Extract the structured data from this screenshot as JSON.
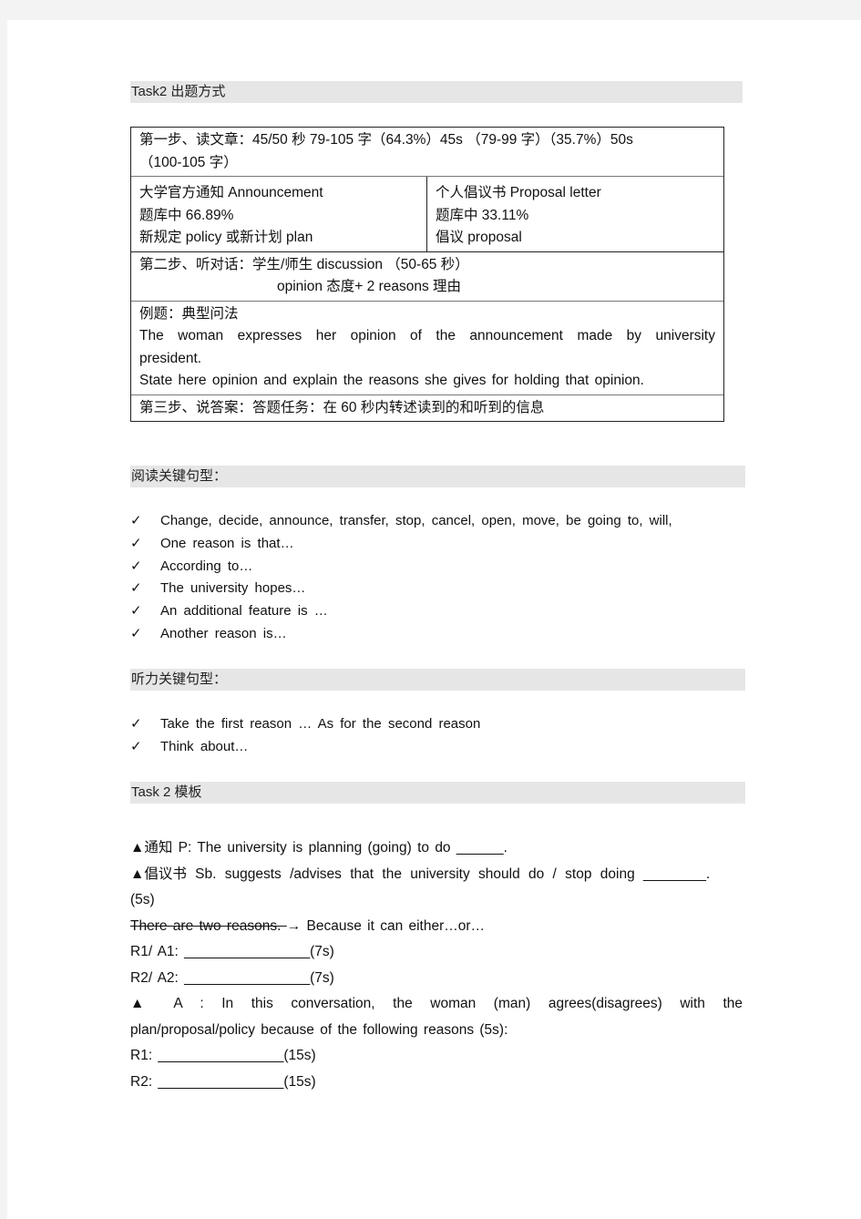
{
  "section1": {
    "header": "Task2   出题方式",
    "table": {
      "step1_line1": "第一步、读文章：45/50 秒  79-105 字（64.3%）45s  （79-99 字）（35.7%）50s",
      "step1_line2": "（100-105 字）",
      "left": [
        "大学官方通知      Announcement",
        "题库中 66.89%",
        "新规定 policy 或新计划 plan"
      ],
      "right": [
        "个人倡议书 Proposal  letter",
        "题库中 33.11%",
        "倡议 proposal"
      ],
      "step2_line1": "第二步、听对话：学生/师生 discussion    （50-65 秒）",
      "step2_line2": "opinion 态度+ 2 reasons 理由",
      "example_title": "例题：典型问法",
      "example_line1": "The woman expresses her opinion of the announcement made by university",
      "example_line2": "president.",
      "example_line3": "State here opinion and explain the reasons she gives for holding that opinion.",
      "step3": "第三步、说答案：答题任务：在 60 秒内转述读到的和听到的信息"
    }
  },
  "section2": {
    "header": "阅读关键句型：",
    "items": [
      "Change, decide, announce, transfer, stop, cancel, open, move, be going to, will,",
      "One reason is that…",
      "According to…",
      "The university hopes…",
      "An additional feature is …",
      "Another reason is…"
    ]
  },
  "section3": {
    "header": "听力关键句型：",
    "items": [
      "Take the first reason … As for the second reason",
      "Think about…"
    ]
  },
  "section4": {
    "header": "Task 2 模板",
    "triangle": "▲",
    "line1": "通知  P: The university is planning (going) to do ______.",
    "line2": "倡议书 Sb. suggests /advises that the university should do / stop doing ________.",
    "line3": "(5s)",
    "line4_struck": "There are two reasons. ",
    "line4_arrow": "→",
    "line4_rest": " Because it can either…or…",
    "line5": "R1/ A1:  ________________(7s)",
    "line6": "R2/ A2:  ________________(7s)",
    "line7": " A :  In  this  conversation,  the  woman  (man)  agrees(disagrees)  with  the",
    "line8": "plan/proposal/policy because of the following reasons (5s):",
    "line9": "R1:  ________________(15s)",
    "line10": "R2:  ________________(15s)"
  },
  "check_icon": "✓"
}
